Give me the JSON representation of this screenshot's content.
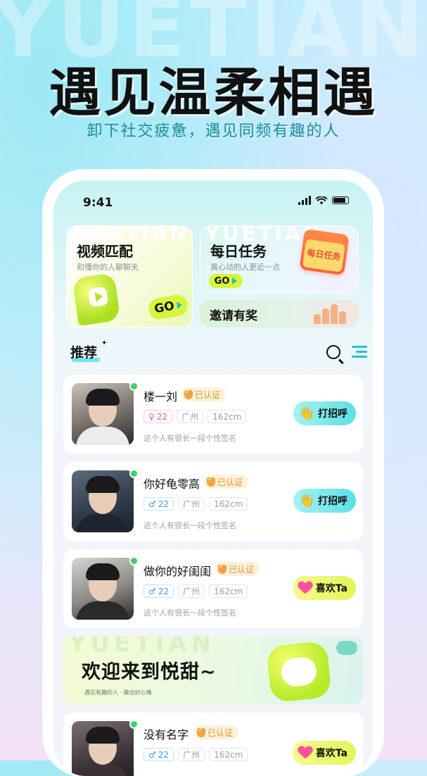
{
  "promo": {
    "watermark": "YUETIAN",
    "headline": "遇见温柔相遇",
    "subheadline": "卸下社交疲惫，遇见同频有趣的人"
  },
  "status_bar": {
    "time": "9:41"
  },
  "features": {
    "video": {
      "watermark": "YUETIAN",
      "title": "视频匹配",
      "subtitle": "和懂你的人聊聊天",
      "go_label": "GO"
    },
    "task": {
      "watermark": "YUETIAN",
      "title": "每日任务",
      "subtitle": "离心动的人更近一点",
      "go_label": "GO",
      "calendar_label": "每日任务"
    },
    "invite": {
      "title": "邀请有奖"
    }
  },
  "section": {
    "title": "推荐"
  },
  "users": [
    {
      "name": "楼一刘",
      "verified": "已认证",
      "gender_symbol": "♀",
      "age": "22",
      "city": "广州",
      "height": "162cm",
      "signature": "这个人有很长一段个性签名",
      "action": "打招呼"
    },
    {
      "name": "你好龟零高",
      "verified": "已认证",
      "gender_symbol": "♂",
      "age": "22",
      "city": "广州",
      "height": "162cm",
      "signature": "这个人有很长一段个性签名",
      "action": "打招呼"
    },
    {
      "name": "做你的好闺闺",
      "verified": "已认证",
      "gender_symbol": "♂",
      "age": "22",
      "city": "广州",
      "height": "162cm",
      "signature": "这个人有很长一段个性签名",
      "action": "喜欢Ta"
    },
    {
      "name": "没有名字",
      "verified": "已认证",
      "gender_symbol": "♂",
      "age": "22",
      "city": "广州",
      "height": "162cm",
      "signature": "",
      "action": "喜欢Ta"
    }
  ],
  "banner": {
    "watermark": "YUETIAN",
    "title": "欢迎来到悦甜~",
    "subtitle": "遇见有趣的人 · 聊出好心情"
  },
  "colors": {
    "accent_cyan": "#4fe0e0",
    "accent_lime": "#d6f53c",
    "online": "#3ed16a",
    "verified": "#e6932b"
  }
}
